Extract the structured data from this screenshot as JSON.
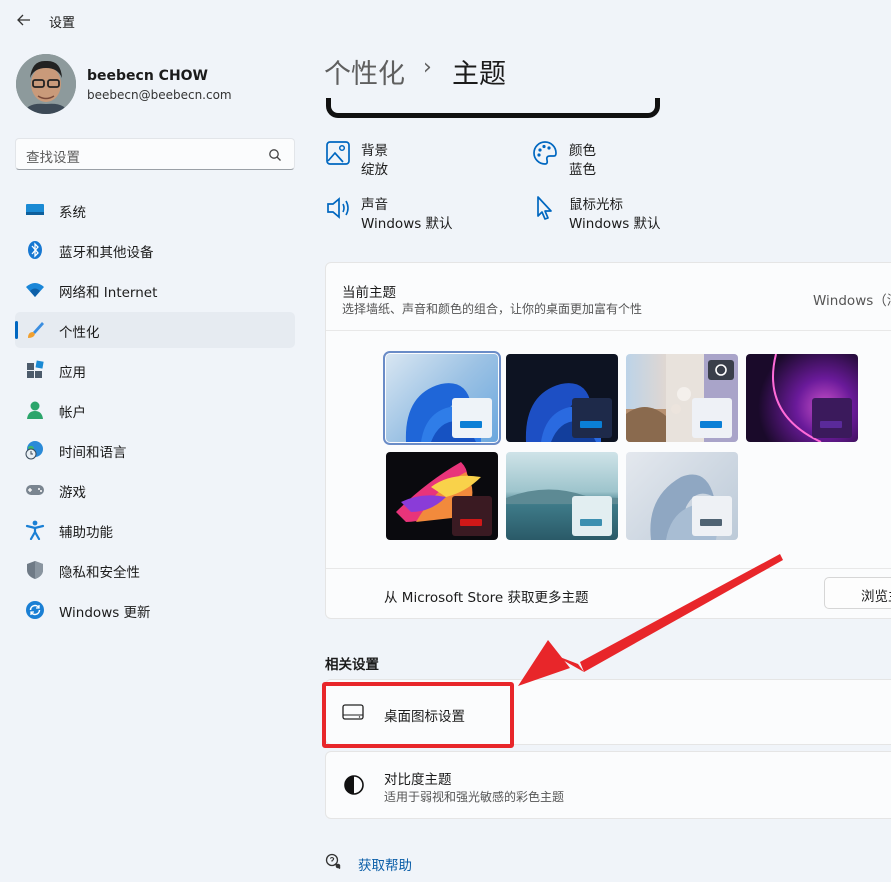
{
  "app": {
    "title": "设置"
  },
  "profile": {
    "name": "beebecn CHOW",
    "email": "beebecn@beebecn.com"
  },
  "search": {
    "placeholder": "查找设置"
  },
  "nav": [
    {
      "label": "系统",
      "icon": "system-icon"
    },
    {
      "label": "蓝牙和其他设备",
      "icon": "bluetooth-icon"
    },
    {
      "label": "网络和 Internet",
      "icon": "wifi-icon"
    },
    {
      "label": "个性化",
      "icon": "brush-icon",
      "selected": true
    },
    {
      "label": "应用",
      "icon": "apps-icon"
    },
    {
      "label": "帐户",
      "icon": "account-icon"
    },
    {
      "label": "时间和语言",
      "icon": "globe-clock-icon"
    },
    {
      "label": "游戏",
      "icon": "gamepad-icon"
    },
    {
      "label": "辅助功能",
      "icon": "accessibility-icon"
    },
    {
      "label": "隐私和安全性",
      "icon": "shield-icon"
    },
    {
      "label": "Windows 更新",
      "icon": "update-icon"
    }
  ],
  "breadcrumb": {
    "parent": "个性化",
    "separator": "›",
    "current": "主题"
  },
  "quick": [
    {
      "title": "背景",
      "value": "绽放",
      "icon": "picture-icon"
    },
    {
      "title": "颜色",
      "value": "蓝色",
      "icon": "palette-icon"
    },
    {
      "title": "声音",
      "value": "Windows 默认",
      "icon": "speaker-icon"
    },
    {
      "title": "鼠标光标",
      "value": "Windows 默认",
      "icon": "cursor-icon"
    }
  ],
  "current_theme": {
    "title": "当前主题",
    "description": "选择墙纸、声音和颜色的组合，让你的桌面更加富有个性",
    "value": "Windows（浅"
  },
  "themes": [
    {
      "name": "windows-light",
      "accent": "#0a7fd6",
      "selected": true
    },
    {
      "name": "windows-dark",
      "accent": "#0a7fd6"
    },
    {
      "name": "photo-spotlight",
      "accent": "#0a7fd6"
    },
    {
      "name": "glow",
      "accent": "#5a2a9a"
    },
    {
      "name": "captured-motion",
      "accent": "#d01818"
    },
    {
      "name": "sunrise",
      "accent": "#3b8fb0"
    },
    {
      "name": "flow",
      "accent": "#4f6373"
    }
  ],
  "store": {
    "text": "从 Microsoft Store 获取更多主题",
    "button": "浏览主"
  },
  "related": {
    "heading": "相关设置",
    "desktop_icons": "桌面图标设置",
    "contrast_title": "对比度主题",
    "contrast_desc": "适用于弱视和强光敏感的彩色主题"
  },
  "help": {
    "label": "获取帮助"
  },
  "annotation": {
    "color": "#e8262a"
  }
}
